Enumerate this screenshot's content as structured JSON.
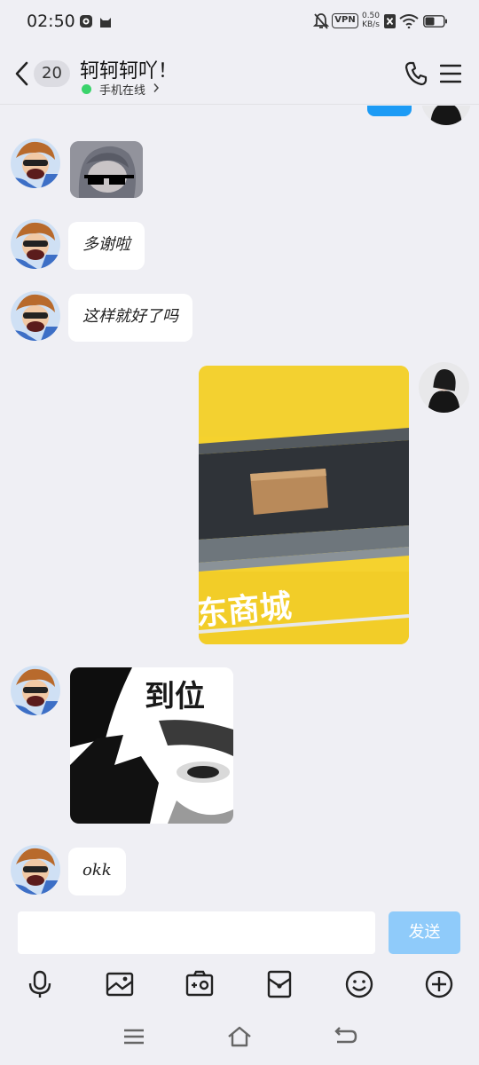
{
  "status_bar": {
    "time": "02:50",
    "vpn_label": "VPN",
    "net_speed_value": "0.50",
    "net_speed_unit": "KB/s",
    "icons": [
      "shield-app-icon",
      "cat-app-icon",
      "mute-bell-icon",
      "vpn-icon",
      "no-sim-icon",
      "wifi-icon",
      "battery-icon"
    ]
  },
  "header": {
    "unread_count": "20",
    "contact_name": "轲轲轲吖！",
    "online_status": "手机在线",
    "colors": {
      "online_dot": "#3ad36b"
    }
  },
  "messages": [
    {
      "side": "right",
      "type": "image-partial",
      "content": ""
    },
    {
      "side": "left",
      "type": "sticker",
      "content": "anime-sunglasses-sticker"
    },
    {
      "side": "left",
      "type": "text",
      "content": "多谢啦"
    },
    {
      "side": "left",
      "type": "text",
      "content": "这样就好了吗"
    },
    {
      "side": "right",
      "type": "photo",
      "content": "parcel-locker-photo",
      "photo_text": "东商城"
    },
    {
      "side": "left",
      "type": "sticker",
      "content": "到位",
      "sticker_text": "到位"
    },
    {
      "side": "left",
      "type": "text",
      "content": "okk"
    }
  ],
  "input": {
    "value": "",
    "placeholder": "",
    "send_label": "发送",
    "send_color": "#8fcbfa"
  },
  "toolbar": {
    "items": [
      "microphone-icon",
      "image-icon",
      "camera-icon",
      "red-packet-icon",
      "emoji-icon",
      "plus-icon"
    ]
  },
  "nav": {
    "items": [
      "recents-icon",
      "home-icon",
      "back-nav-icon"
    ]
  }
}
